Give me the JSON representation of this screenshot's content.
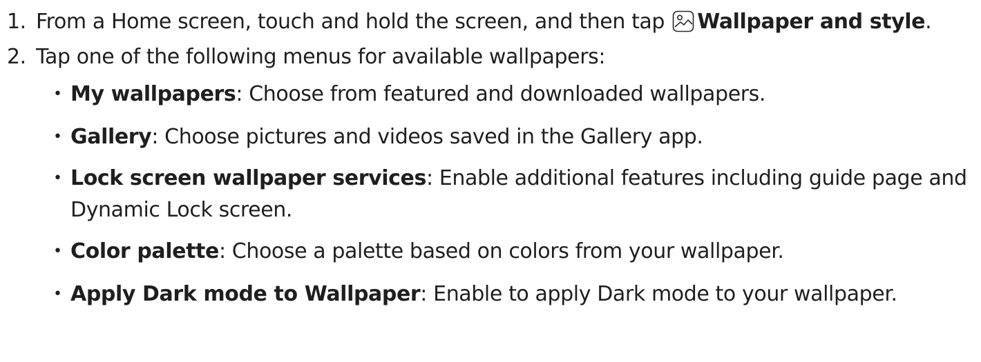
{
  "step1": {
    "number": "1.",
    "text_before": "From a Home screen, touch and hold the screen, and then tap",
    "icon": "wallpaper-picture-icon",
    "bold": "Wallpaper and style",
    "text_after": "."
  },
  "step2": {
    "number": "2.",
    "text": "Tap one of the following menus for available wallpapers:",
    "items": [
      {
        "term": "My wallpapers",
        "desc": ": Choose from featured and downloaded wallpapers."
      },
      {
        "term": "Gallery",
        "desc": ": Choose pictures and videos saved in the Gallery app."
      },
      {
        "term": "Lock screen wallpaper services",
        "desc": ": Enable additional features including guide page and Dynamic Lock screen."
      },
      {
        "term": "Color palette",
        "desc": ": Choose a palette based on colors from your wallpaper."
      },
      {
        "term": "Apply Dark mode to Wallpaper",
        "desc": ": Enable to apply Dark mode to your wallpaper."
      }
    ]
  }
}
